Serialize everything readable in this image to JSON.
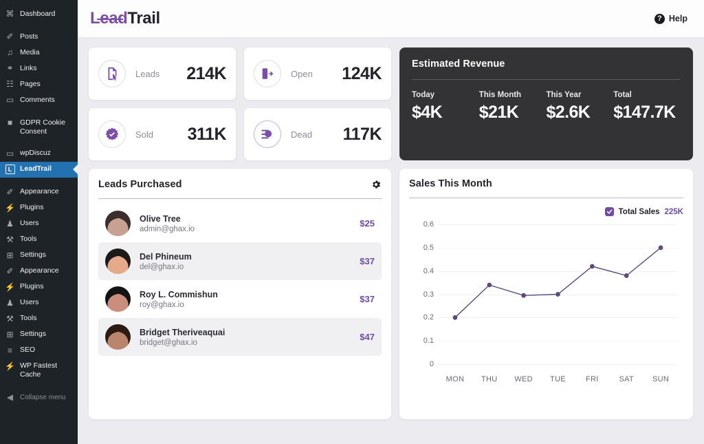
{
  "wp_sidebar": {
    "items": [
      {
        "label": "Dashboard",
        "icon": "dashboard-icon",
        "glyph": "⌘",
        "gap": false
      },
      {
        "label": "Posts",
        "icon": "pin-icon",
        "glyph": "✐",
        "gap": true
      },
      {
        "label": "Media",
        "icon": "media-icon",
        "glyph": "♫",
        "gap": false
      },
      {
        "label": "Links",
        "icon": "link-icon",
        "glyph": "⚭",
        "gap": false
      },
      {
        "label": "Pages",
        "icon": "pages-icon",
        "glyph": "☷",
        "gap": false
      },
      {
        "label": "Comments",
        "icon": "comment-icon",
        "glyph": "▭",
        "gap": false
      },
      {
        "label": "GDPR Cookie Consent",
        "icon": "lock-icon",
        "glyph": "■",
        "gap": true
      },
      {
        "label": "wpDiscuz",
        "icon": "comment-icon",
        "glyph": "▭",
        "gap": true
      },
      {
        "label": "LeadTrail",
        "icon": "leadtrail-icon",
        "glyph": "L",
        "gap": false,
        "active": true
      },
      {
        "label": "Appearance",
        "icon": "brush-icon",
        "glyph": "✐",
        "gap": true
      },
      {
        "label": "Plugins",
        "icon": "plug-icon",
        "glyph": "⚡",
        "gap": false
      },
      {
        "label": "Users",
        "icon": "users-icon",
        "glyph": "♟",
        "gap": false
      },
      {
        "label": "Tools",
        "icon": "tools-icon",
        "glyph": "⚒",
        "gap": false
      },
      {
        "label": "Settings",
        "icon": "settings-icon",
        "glyph": "⊞",
        "gap": false
      },
      {
        "label": "Appearance",
        "icon": "brush-icon",
        "glyph": "✐",
        "gap": false
      },
      {
        "label": "Plugins",
        "icon": "plug-icon",
        "glyph": "⚡",
        "gap": false
      },
      {
        "label": "Users",
        "icon": "users-icon",
        "glyph": "♟",
        "gap": false
      },
      {
        "label": "Tools",
        "icon": "tools-icon",
        "glyph": "⚒",
        "gap": false
      },
      {
        "label": "Settings",
        "icon": "settings-icon",
        "glyph": "⊞",
        "gap": false
      },
      {
        "label": "SEO",
        "icon": "seo-icon",
        "glyph": "≡",
        "gap": false
      },
      {
        "label": "WP Fastest Cache",
        "icon": "cache-icon",
        "glyph": "⚡",
        "gap": false
      }
    ],
    "collapse_label": "Collapse menu",
    "collapse_icon": "chevron-left-icon",
    "active_color": "#2271b1",
    "background": "#1d2327"
  },
  "topbar": {
    "logo_first": "Lead",
    "logo_second": "Trail",
    "logo_color": "#7b4fa8",
    "help_label": "Help",
    "help_icon": "question-circle-icon"
  },
  "stats": [
    {
      "label": "Leads",
      "value": "214K",
      "icon": "document-cursor-icon",
      "accent_ring": false
    },
    {
      "label": "Open",
      "value": "124K",
      "icon": "open-door-icon",
      "accent_ring": false
    },
    {
      "label": "Sold",
      "value": "311K",
      "icon": "verified-badge-icon",
      "accent_ring": false
    },
    {
      "label": "Dead",
      "value": "117K",
      "icon": "list-remove-icon",
      "accent_ring": true
    }
  ],
  "revenue": {
    "title": "Estimated Revenue",
    "cells": [
      {
        "key": "Today",
        "value": "$4K"
      },
      {
        "key": "This Month",
        "value": "$21K"
      },
      {
        "key": "This Year",
        "value": "$2.6K"
      },
      {
        "key": "Total",
        "value": "$147.7K"
      }
    ]
  },
  "leads_panel": {
    "title": "Leads Purchased",
    "gear_icon": "gear-icon",
    "rows": [
      {
        "name": "Olive Tree",
        "email": "admin@ghax.io",
        "price": "$25",
        "skin": "#c9a193",
        "hair": "#3a2f2c"
      },
      {
        "name": "Del Phineum",
        "email": "del@ghax.io",
        "price": "$37",
        "skin": "#e6a98a",
        "hair": "#1d1a1a"
      },
      {
        "name": "Roy L. Commishun",
        "email": "roy@ghax.io",
        "price": "$37",
        "skin": "#c98f7c",
        "hair": "#151414"
      },
      {
        "name": "Bridget Theriveaquai",
        "email": "bridget@ghax.io",
        "price": "$47",
        "skin": "#b9856c",
        "hair": "#2a1c14"
      }
    ]
  },
  "chart_panel": {
    "title": "Sales This Month",
    "legend_label": "Total Sales",
    "legend_value": "225K",
    "legend_checked": true,
    "accent": "#6f4da3"
  },
  "chart_data": {
    "type": "line",
    "title": "Sales This Month",
    "xlabel": "",
    "ylabel": "",
    "categories": [
      "MON",
      "THU",
      "WED",
      "TUE",
      "FRI",
      "SAT",
      "SUN"
    ],
    "series": [
      {
        "name": "Total Sales",
        "values": [
          0.2,
          0.34,
          0.295,
          0.3,
          0.42,
          0.38,
          0.5
        ]
      }
    ],
    "yticks": [
      "0.6",
      "0.5",
      "0.4",
      "0.3",
      "0.2",
      "0.1",
      "0"
    ],
    "ytick_values": [
      0.6,
      0.5,
      0.4,
      0.3,
      0.2,
      0.1,
      0
    ],
    "ylim": [
      0,
      0.6
    ],
    "grid": true,
    "legend_position": "top-right",
    "line_color": "#5b4a78",
    "marker_color": "#5b4a78"
  }
}
